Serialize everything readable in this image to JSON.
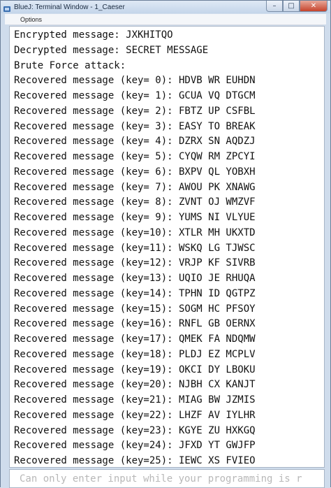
{
  "window": {
    "title": "BlueJ: Terminal Window - 1_Caeser",
    "controls": {
      "minimize": "–",
      "maximize": "□",
      "close": "✕"
    },
    "icon": "bluej-app-icon"
  },
  "menu": {
    "items": [
      {
        "label": "Options"
      }
    ]
  },
  "console": {
    "lines": [
      "Encrypted message: JXKHITQO",
      "Decrypted message: SECRET MESSAGE",
      "Brute Force attack:",
      "Recovered message (key= 0): HDVB WR EUHDN",
      "Recovered message (key= 1): GCUA VQ DTGCM",
      "Recovered message (key= 2): FBTZ UP CSFBL",
      "Recovered message (key= 3): EASY TO BREAK",
      "Recovered message (key= 4): DZRX SN AQDZJ",
      "Recovered message (key= 5): CYQW RM ZPCYI",
      "Recovered message (key= 6): BXPV QL YOBXH",
      "Recovered message (key= 7): AWOU PK XNAWG",
      "Recovered message (key= 8): ZVNT OJ WMZVF",
      "Recovered message (key= 9): YUMS NI VLYUE",
      "Recovered message (key=10): XTLR MH UKXTD",
      "Recovered message (key=11): WSKQ LG TJWSC",
      "Recovered message (key=12): VRJP KF SIVRB",
      "Recovered message (key=13): UQIO JE RHUQA",
      "Recovered message (key=14): TPHN ID QGTPZ",
      "Recovered message (key=15): SOGM HC PFSOY",
      "Recovered message (key=16): RNFL GB OERNX",
      "Recovered message (key=17): QMEK FA NDQMW",
      "Recovered message (key=18): PLDJ EZ MCPLV",
      "Recovered message (key=19): OKCI DY LBOKU",
      "Recovered message (key=20): NJBH CX KANJT",
      "Recovered message (key=21): MIAG BW JZMIS",
      "Recovered message (key=22): LHZF AV IYLHR",
      "Recovered message (key=23): KGYE ZU HXKGQ",
      "Recovered message (key=24): JFXD YT GWJFP",
      "Recovered message (key=25): IEWC XS FVIEO"
    ]
  },
  "input": {
    "placeholder": "Can only enter input while your programming is r"
  },
  "colors": {
    "frame": "#cfdcec",
    "console_bg": "#ffffff",
    "text": "#111111",
    "placeholder": "#b8b8b8",
    "close_button": "#c6432c"
  }
}
